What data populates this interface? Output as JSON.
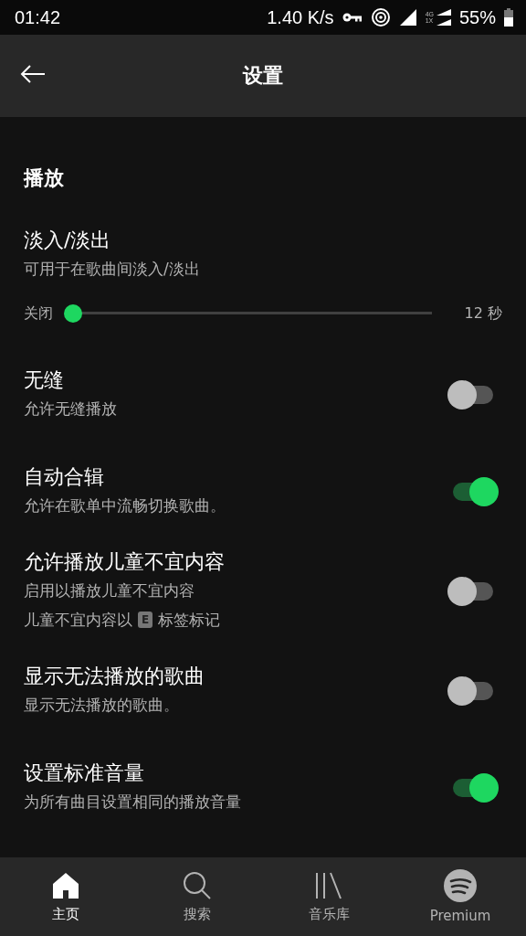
{
  "status_bar": {
    "time": "01:42",
    "speed": "1.40 K/s",
    "network_label_top": "4G",
    "network_label_bottom": "1X",
    "battery": "55%"
  },
  "header": {
    "title": "设置"
  },
  "section": {
    "title": "播放"
  },
  "fade": {
    "title": "淡入/淡出",
    "subtitle": "可用于在歌曲间淡入/淡出",
    "min_label": "关闭",
    "max_label": "12 秒",
    "level": 0
  },
  "toggles": [
    {
      "title": "无缝",
      "lines": [
        {
          "text": "允许无缝播放"
        }
      ],
      "on": false
    },
    {
      "title": "自动合辑",
      "lines": [
        {
          "text": "允许在歌单中流畅切换歌曲。"
        }
      ],
      "on": true
    },
    {
      "title": "允许播放儿童不宜内容",
      "lines": [
        {
          "text": "启用以播放儿童不宜内容"
        },
        {
          "text": "儿童不宜内容以",
          "tag": "E",
          "after": "标签标记"
        }
      ],
      "on": false
    },
    {
      "title": "显示无法播放的歌曲",
      "lines": [
        {
          "text": "显示无法播放的歌曲。"
        }
      ],
      "on": false
    },
    {
      "title": "设置标准音量",
      "lines": [
        {
          "text": "为所有曲目设置相同的播放音量"
        }
      ],
      "on": true
    }
  ],
  "nav": [
    {
      "kind": "home",
      "label": "主页",
      "selected": true
    },
    {
      "kind": "search",
      "label": "搜索",
      "selected": false
    },
    {
      "kind": "library",
      "label": "音乐库",
      "selected": false
    },
    {
      "kind": "premium",
      "label": "Premium",
      "selected": false
    }
  ]
}
